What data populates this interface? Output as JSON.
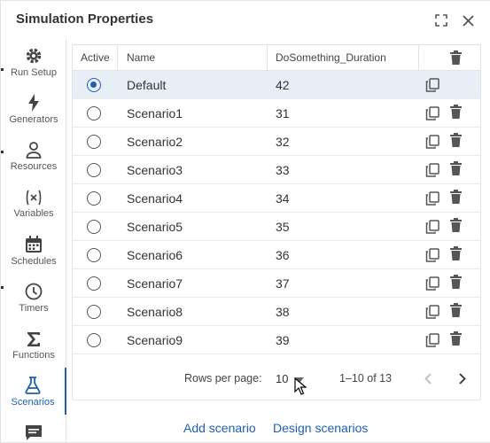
{
  "window": {
    "title": "Simulation Properties",
    "expand_icon": "expand-icon",
    "close_icon": "close-icon"
  },
  "sidebar": {
    "items": [
      {
        "label": "Run Setup",
        "icon": "gear-icon",
        "active": false
      },
      {
        "label": "Generators",
        "icon": "lightning-icon",
        "active": false
      },
      {
        "label": "Resources",
        "icon": "person-icon",
        "active": false
      },
      {
        "label": "Variables",
        "icon": "variable-icon",
        "active": false
      },
      {
        "label": "Schedules",
        "icon": "calendar-icon",
        "active": false
      },
      {
        "label": "Timers",
        "icon": "clock-icon",
        "active": false
      },
      {
        "label": "Functions",
        "icon": "sigma-icon",
        "active": false
      },
      {
        "label": "Scenarios",
        "icon": "flask-icon",
        "active": true
      },
      {
        "label": "",
        "icon": "comment-icon",
        "active": false
      }
    ]
  },
  "table": {
    "columns": [
      "Active",
      "Name",
      "DoSomething_Duration"
    ],
    "header_delete_icon": "trash-icon",
    "rows": [
      {
        "active": true,
        "name": "Default",
        "duration": "42",
        "deletable": false
      },
      {
        "active": false,
        "name": "Scenario1",
        "duration": "31",
        "deletable": true
      },
      {
        "active": false,
        "name": "Scenario2",
        "duration": "32",
        "deletable": true
      },
      {
        "active": false,
        "name": "Scenario3",
        "duration": "33",
        "deletable": true
      },
      {
        "active": false,
        "name": "Scenario4",
        "duration": "34",
        "deletable": true
      },
      {
        "active": false,
        "name": "Scenario5",
        "duration": "35",
        "deletable": true
      },
      {
        "active": false,
        "name": "Scenario6",
        "duration": "36",
        "deletable": true
      },
      {
        "active": false,
        "name": "Scenario7",
        "duration": "37",
        "deletable": true
      },
      {
        "active": false,
        "name": "Scenario8",
        "duration": "38",
        "deletable": true
      },
      {
        "active": false,
        "name": "Scenario9",
        "duration": "39",
        "deletable": true
      }
    ]
  },
  "pagination": {
    "rows_per_page_label": "Rows per page:",
    "rows_per_page_value": "10",
    "range_text": "1–10 of 13"
  },
  "actions": {
    "add_scenario": "Add scenario",
    "design_scenarios": "Design scenarios"
  },
  "colors": {
    "accent": "#1f5fb0",
    "selected_row": "#e8eef6"
  }
}
